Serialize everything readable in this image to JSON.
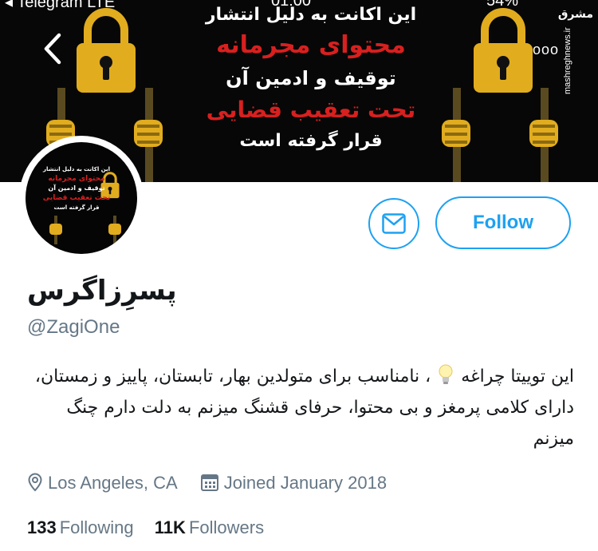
{
  "status_bar": {
    "carrier": "◂ Telegram",
    "network": "LTE",
    "time": "01:00",
    "battery": "54%"
  },
  "banner": {
    "line1": "این اکانت به دلیل انتشار",
    "line2": "محتوای مجرمانه",
    "line3": "توقیف و ادمین آن",
    "line4": "تحت تعقیب قضایی",
    "line5": "قرار گرفته است",
    "watermark_logo": "مشرق",
    "watermark_url": "mashreghnews.ir",
    "more_label": "ooo"
  },
  "profile": {
    "display_name": "پسرِزاگرس",
    "handle": "@ZagiOne",
    "bio_part1": "این توییتا چراغه",
    "bio_part2": "، نامناسب برای متولدین بهار، تابستان، پاییز و زمستان، دارای کلامی پرمغز و بی محتوا، حرفای قشنگ میزنم به دلت دارم چنگ میزنم",
    "location": "Los Angeles, CA",
    "joined": "Joined January 2018",
    "following_count": "133",
    "following_label": "Following",
    "followers_count": "11K",
    "followers_label": "Followers"
  },
  "actions": {
    "follow_label": "Follow"
  },
  "colors": {
    "accent": "#1da1f2",
    "banner_red": "#d8201f",
    "lock_gold": "#e1ac1e",
    "muted_text": "#657786"
  },
  "icons": [
    "back-arrow-icon",
    "padlock-icon",
    "prison-bars-icon",
    "more-icon",
    "message-icon",
    "location-pin-icon",
    "calendar-icon",
    "lightbulb-icon"
  ]
}
